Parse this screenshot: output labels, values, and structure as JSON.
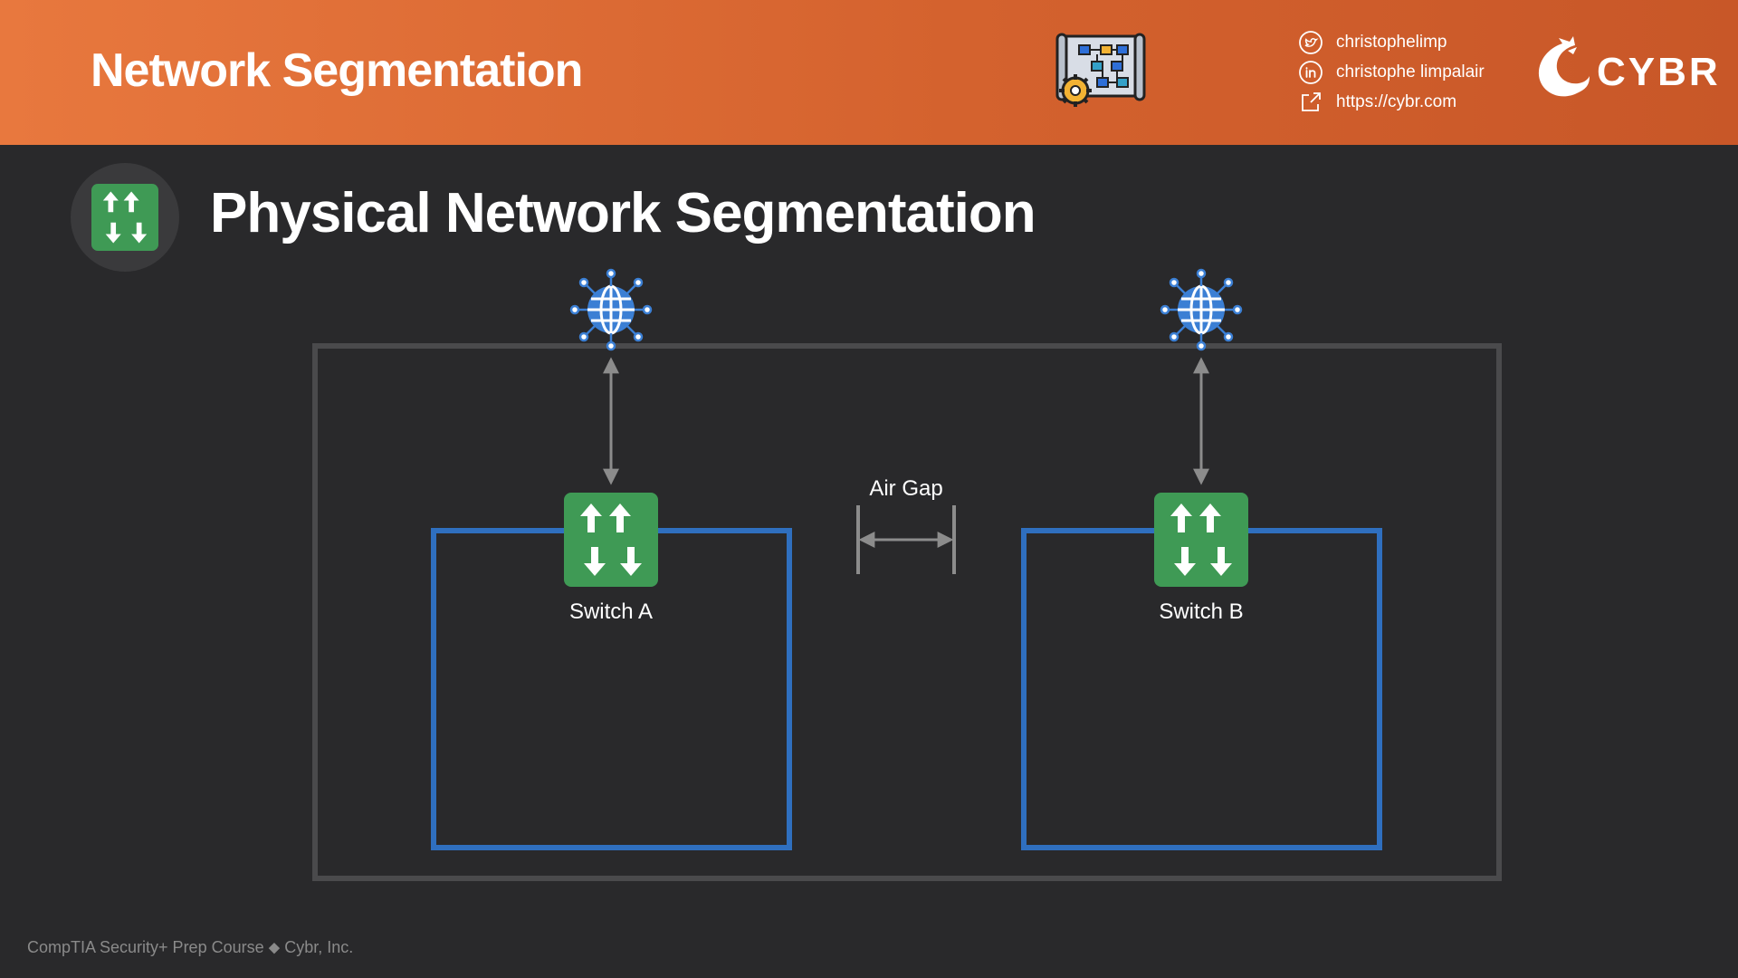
{
  "header": {
    "title": "Network Segmentation",
    "contacts": [
      {
        "icon": "twitter-icon",
        "text": "christophelimp"
      },
      {
        "icon": "linkedin-icon",
        "text": "christophe limpalair"
      },
      {
        "icon": "external-link-icon",
        "text": "https://cybr.com"
      }
    ],
    "brand": "CYBR"
  },
  "slide": {
    "title": "Physical Network Segmentation"
  },
  "diagram": {
    "switch_a_label": "Switch A",
    "switch_b_label": "Switch B",
    "air_gap_label": "Air Gap",
    "colors": {
      "segment_border": "#2f6fbf",
      "outer_border": "#4a4a4c",
      "switch_green": "#3f9a55",
      "globe_blue": "#3b7fd4"
    }
  },
  "footer": {
    "text": "CompTIA Security+ Prep Course ⬥ Cybr, Inc."
  }
}
